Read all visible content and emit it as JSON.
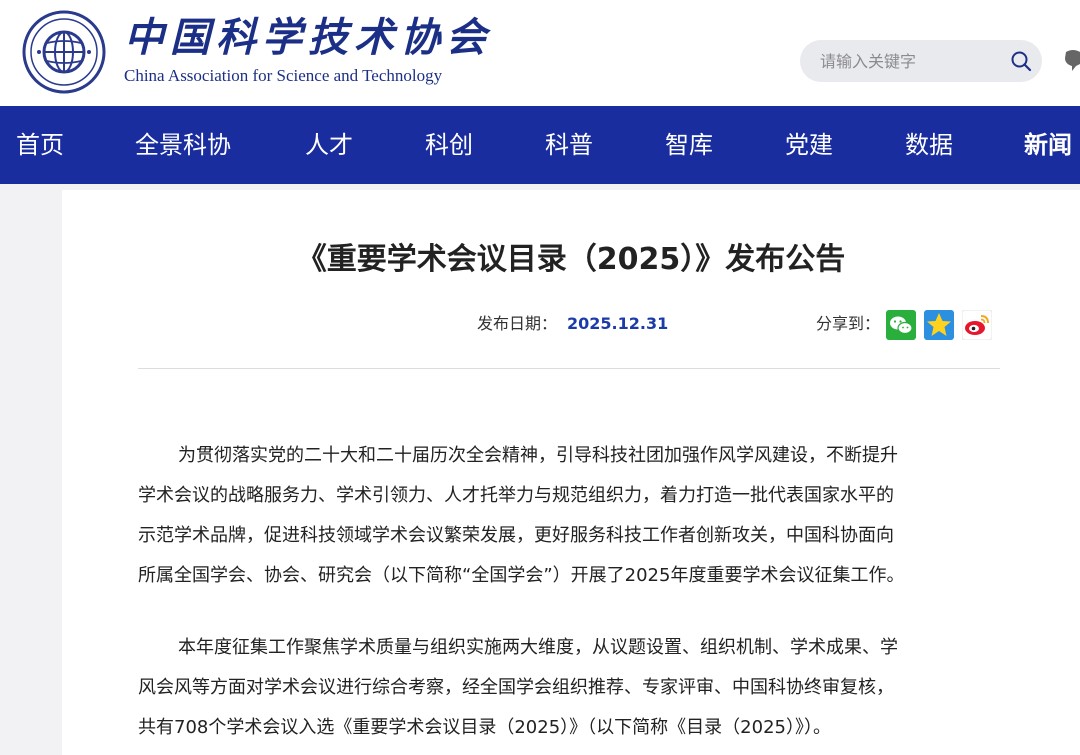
{
  "header": {
    "logo_cn": "中国科学技术协会",
    "logo_en": "China Association for Science and Technology",
    "search_placeholder": "请输入关键字"
  },
  "nav": {
    "items": [
      {
        "label": "首页"
      },
      {
        "label": "全景科协"
      },
      {
        "label": "人才"
      },
      {
        "label": "科创"
      },
      {
        "label": "科普"
      },
      {
        "label": "智库"
      },
      {
        "label": "党建"
      },
      {
        "label": "数据"
      },
      {
        "label": "新闻"
      }
    ]
  },
  "article": {
    "title": "《重要学术会议目录（2025）》发布公告",
    "date_label": "发布日期：",
    "date_value": "2025.12.31",
    "share_label": "分享到：",
    "share_targets": [
      "wechat-icon",
      "qzone-icon",
      "weibo-icon"
    ],
    "paragraphs": [
      {
        "lines": [
          "为贯彻落实党的二十大和二十届历次全会精神，引导科技社团加强作风学风建设，不断提升",
          "学术会议的战略服务力、学术引领力、人才托举力与规范组织力，着力打造一批代表国家水平的",
          "示范学术品牌，促进科技领域学术会议繁荣发展，更好服务科技工作者创新攻关，中国科协面向",
          "所属全国学会、协会、研究会（以下简称“全国学会”）开展了2025年度重要学术会议征集工作。"
        ]
      },
      {
        "lines": [
          "本年度征集工作聚焦学术质量与组织实施两大维度，从议题设置、组织机制、学术成果、学",
          "风会风等方面对学术会议进行综合考察，经全国学会组织推荐、专家评审、中国科协终审复核，",
          "共有708个学术会议入选《重要学术会议目录（2025）》（以下简称《目录（2025）》）。"
        ]
      }
    ]
  },
  "colors": {
    "nav_bg": "#1a2d9e",
    "brand_blue": "#1c2f86",
    "date_blue": "#1c3aa9",
    "page_bg": "#f2f2f4"
  }
}
